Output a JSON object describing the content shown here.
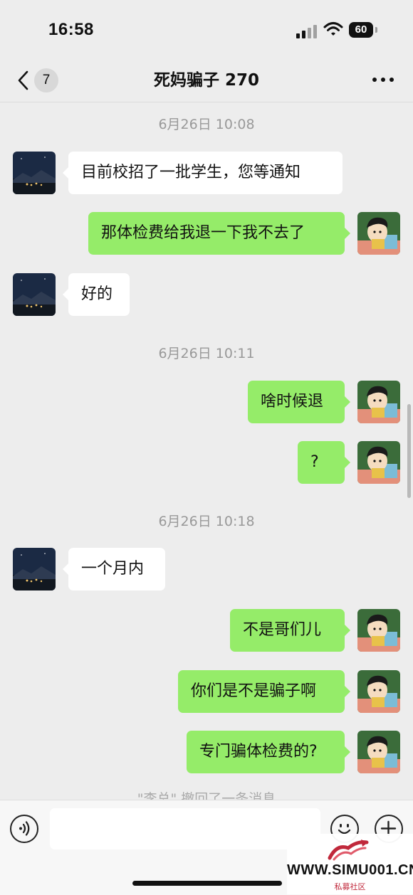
{
  "status_bar": {
    "time": "16:58",
    "battery": "60"
  },
  "nav": {
    "unread_count": "7",
    "title": "死妈骗子 270"
  },
  "messages": [
    {
      "kind": "timestamp",
      "text": "6月26日 10:08"
    },
    {
      "kind": "incoming",
      "text": "目前校招了一批学生，您等通知"
    },
    {
      "kind": "outgoing",
      "text": "那体检费给我退一下我不去了"
    },
    {
      "kind": "incoming",
      "text": "好的"
    },
    {
      "kind": "timestamp",
      "text": "6月26日 10:11"
    },
    {
      "kind": "outgoing",
      "text": "啥时候退"
    },
    {
      "kind": "outgoing",
      "text": "?"
    },
    {
      "kind": "timestamp",
      "text": "6月26日 10:18"
    },
    {
      "kind": "incoming",
      "text": "一个月内"
    },
    {
      "kind": "outgoing",
      "text": "不是哥们儿"
    },
    {
      "kind": "outgoing",
      "text": "你们是不是骗子啊"
    },
    {
      "kind": "outgoing",
      "text": "专门骗体检费的?"
    }
  ],
  "recall_notice": "\"李总\" 撤回了一条消息",
  "input": {
    "value": ""
  },
  "watermark": {
    "text": "WWW.SIMU001.CN",
    "sub": "私募社区"
  },
  "colors": {
    "outgoing_bubble": "#95ec69",
    "incoming_bubble": "#ffffff",
    "background": "#ededed"
  },
  "icons": [
    "back-icon",
    "more-icon",
    "voice-icon",
    "emoji-icon",
    "plus-icon",
    "signal-icon",
    "wifi-icon",
    "battery-icon"
  ]
}
